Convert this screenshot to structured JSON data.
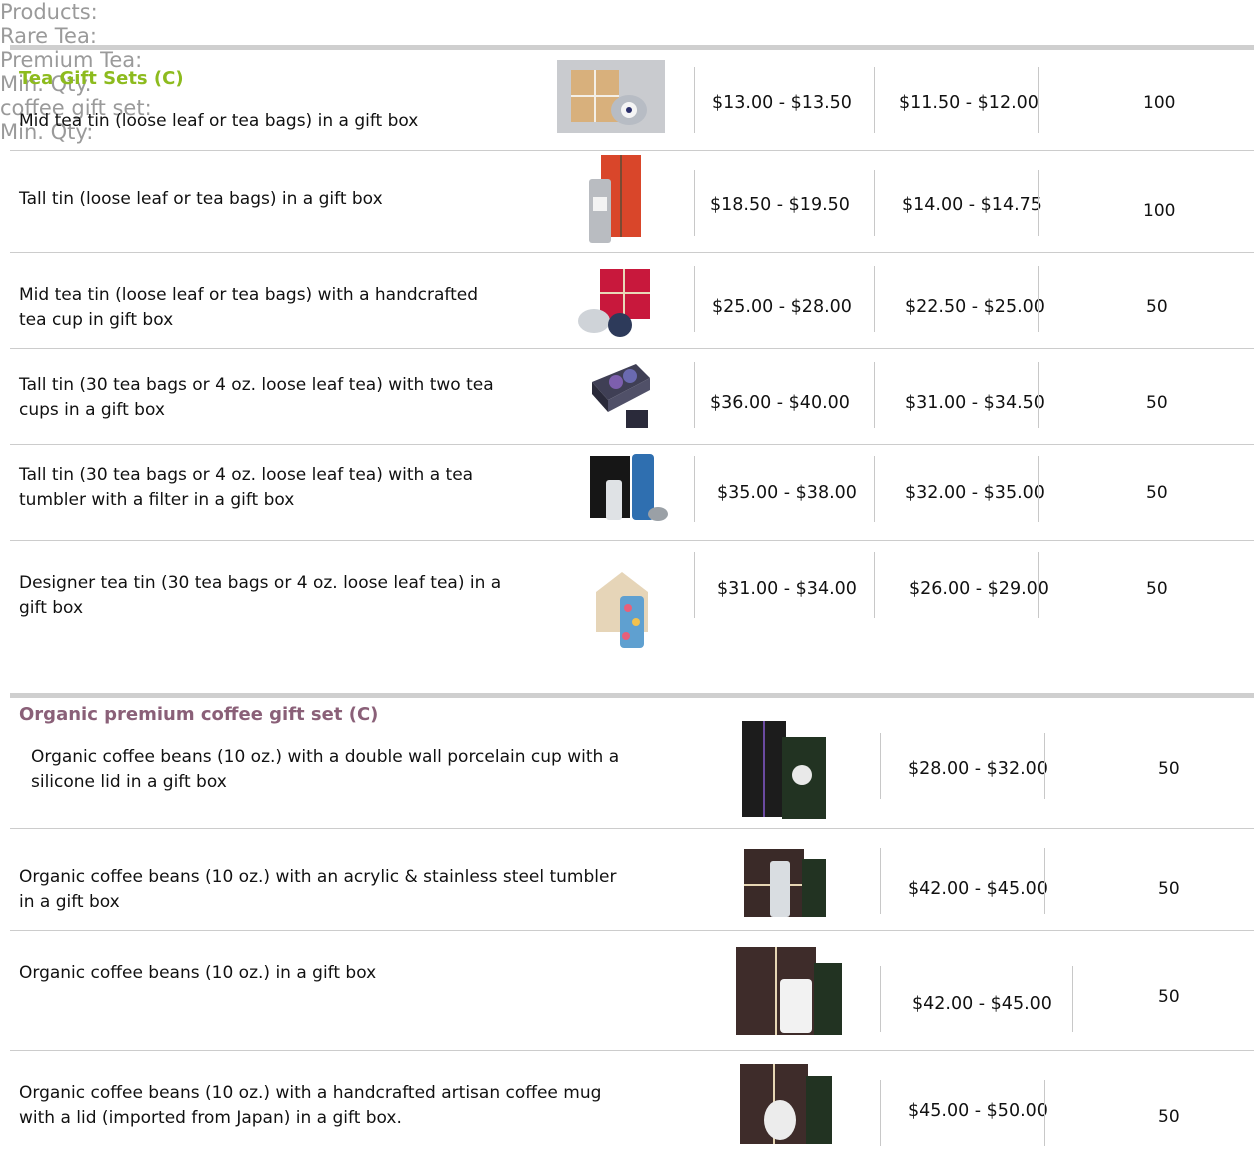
{
  "header": {
    "products": "Products:",
    "rare_tea": "Rare Tea:",
    "premium_tea": "Premium Tea:",
    "min_qty": "Min. Qty."
  },
  "tea_section": {
    "title": "Tea Gift Sets (C)",
    "rows": [
      {
        "desc1": "Mid tea tin (loose leaf or tea bags) in a gift box",
        "desc2": "",
        "rare": "$13.00 - $13.50",
        "premium": "$11.50 - $12.00",
        "qty": "100",
        "image": "kraft-box-with-tin"
      },
      {
        "desc1": "Tall tin (loose leaf or tea bags) in a gift box",
        "desc2": "",
        "rare": "$18.50 - $19.50",
        "premium": "$14.00 - $14.75",
        "qty": "100",
        "image": "red-box-with-tall-tin"
      },
      {
        "desc1": "Mid tea tin (loose leaf or tea bags) with a handcrafted",
        "desc2": "tea cup in gift box",
        "rare": "$25.00 - $28.00",
        "premium": "$22.50 - $25.00",
        "qty": "50",
        "image": "red-box-with-cup"
      },
      {
        "desc1": "Tall tin (30 tea bags or 4 oz. loose leaf tea) with two tea",
        "desc2": "cups in a gift box",
        "rare": "$36.00 - $40.00",
        "premium": "$31.00 - $34.50",
        "qty": "50",
        "image": "open-box-two-cups"
      },
      {
        "desc1": "Tall tin (30 tea bags or 4 oz. loose leaf tea) with a tea",
        "desc2": "tumbler with a filter in a gift box",
        "rare": "$35.00 - $38.00",
        "premium": "$32.00 - $35.00",
        "qty": "50",
        "image": "black-box-tumbler"
      },
      {
        "desc1": "Designer tea tin (30 tea bags or 4 oz. loose leaf tea) in a",
        "desc2": "gift box",
        "rare": "$31.00 - $34.00",
        "premium": "$26.00 - $29.00",
        "qty": "50",
        "image": "designer-tin"
      }
    ]
  },
  "coffee_header": {
    "gift_set": "coffee gift set:",
    "min_qty": "Min. Qty:"
  },
  "coffee_section": {
    "title": "Organic premium coffee gift set (C)",
    "rows": [
      {
        "desc1": "Organic coffee beans (10 oz.) with a double wall porcelain cup with a",
        "desc2": "silicone lid in a gift box",
        "price": "$28.00 - $32.00",
        "qty": "50",
        "image": "black-box-coffee-bag"
      },
      {
        "desc1": "Organic coffee beans (10 oz.) with an acrylic & stainless steel tumbler",
        "desc2": "in a gift box",
        "price": "$42.00 - $45.00",
        "qty": "50",
        "image": "brown-box-tumbler"
      },
      {
        "desc1": "Organic coffee beans (10 oz.)  in a gift box",
        "desc2": "",
        "price": "$42.00 - $45.00",
        "qty": "50",
        "image": "brown-box-cup"
      },
      {
        "desc1": "Organic coffee beans (10 oz.) with a handcrafted artisan coffee mug",
        "desc2": "with a lid (imported from Japan) in a gift box.",
        "price": "$45.00 - $50.00",
        "qty": "50",
        "image": "brown-box-mug"
      }
    ]
  },
  "colors": {
    "tea_title": "#8dbb1e",
    "coffee_title": "#8a6078",
    "header_text": "#9a9a9a",
    "rule": "#cfcfcf"
  }
}
